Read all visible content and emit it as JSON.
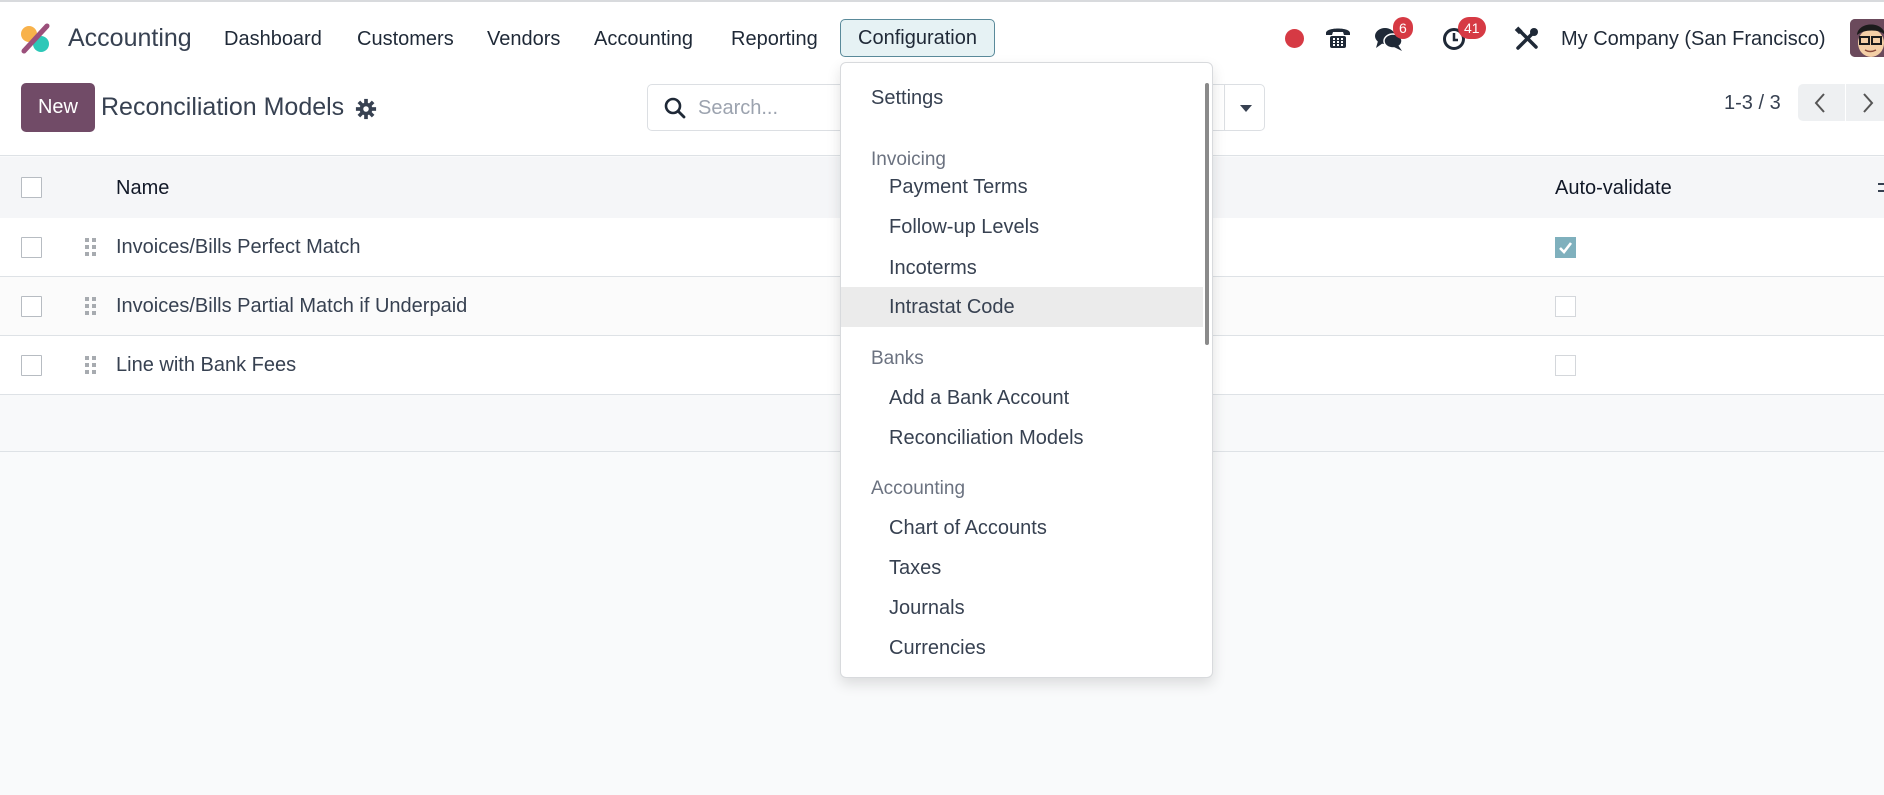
{
  "app": {
    "brand": "Accounting",
    "logo_icon": "odoo-accounting-logo",
    "colors": {
      "brand_primary": "#714b67",
      "active_menu_bg": "#e6f2f4",
      "badge": "#d63a44",
      "checkbox_checked": "#7fb0bd"
    }
  },
  "navbar": {
    "menu": [
      {
        "label": "Dashboard"
      },
      {
        "label": "Customers"
      },
      {
        "label": "Vendors"
      },
      {
        "label": "Accounting"
      },
      {
        "label": "Reporting"
      },
      {
        "label": "Configuration",
        "active": true
      }
    ],
    "systray": {
      "recording_icon": "red-dot-icon",
      "phone_icon": "phone-icon",
      "messages_icon": "chat-icon",
      "messages_count": "6",
      "activities_icon": "clock-icon",
      "activities_count": "41",
      "debug_icon": "tools-icon",
      "company": "My Company (San Francisco)",
      "avatar": "user-avatar"
    }
  },
  "control_panel": {
    "new_label": "New",
    "title": "Reconciliation Models",
    "gear_icon": "gear-icon",
    "search": {
      "placeholder": "Search...",
      "value": ""
    },
    "pager": {
      "value": "1-3 / 3"
    }
  },
  "table": {
    "columns": {
      "name": "Name",
      "auto_validate": "Auto-validate"
    },
    "rows": [
      {
        "name": "Invoices/Bills Perfect Match",
        "auto_validate": true
      },
      {
        "name": "Invoices/Bills Partial Match if Underpaid",
        "auto_validate": false
      },
      {
        "name": "Line with Bank Fees",
        "auto_validate": false
      }
    ]
  },
  "config_menu": {
    "settings": "Settings",
    "sections": [
      {
        "header": "Invoicing",
        "items": [
          "Payment Terms",
          "Follow-up Levels",
          "Incoterms",
          "Intrastat Code"
        ]
      },
      {
        "header": "Banks",
        "items": [
          "Add a Bank Account",
          "Reconciliation Models"
        ]
      },
      {
        "header": "Accounting",
        "items": [
          "Chart of Accounts",
          "Taxes",
          "Journals",
          "Currencies"
        ]
      }
    ],
    "hovered_item": "Intrastat Code"
  }
}
